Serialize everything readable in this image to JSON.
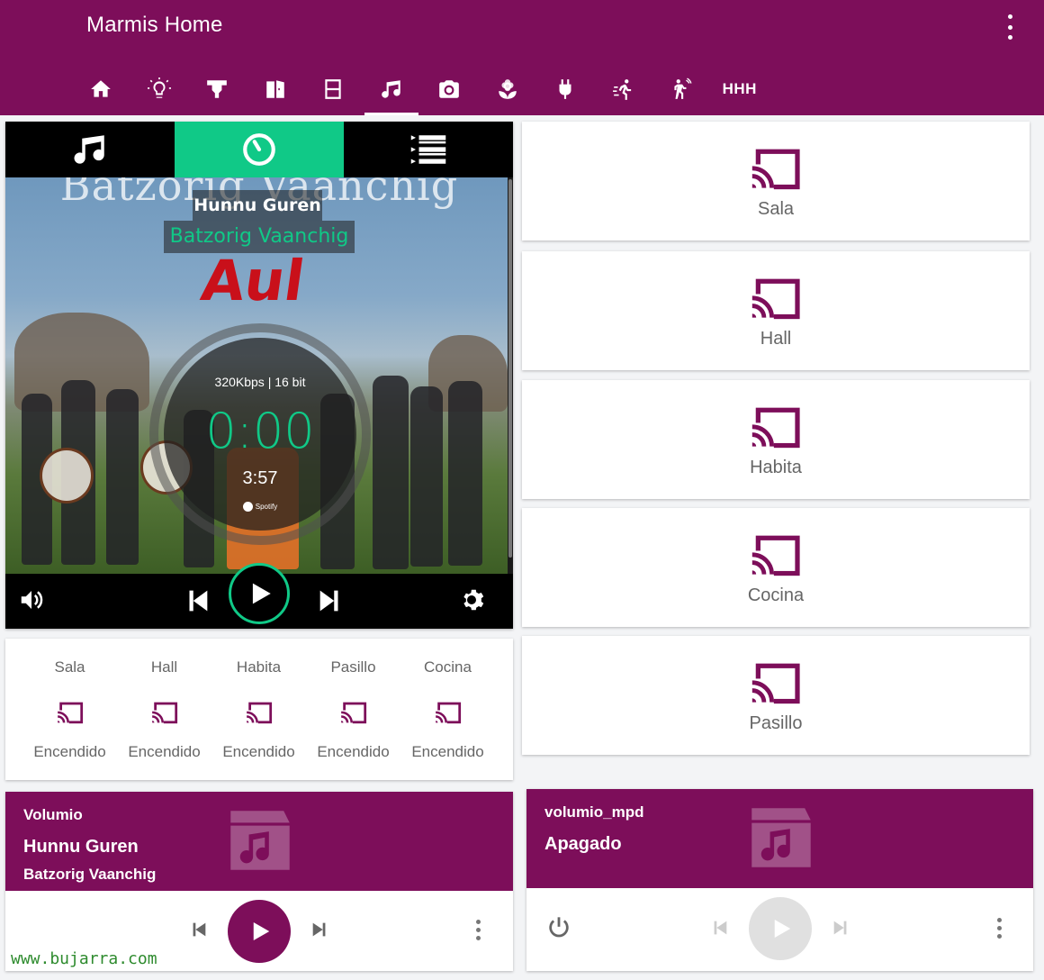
{
  "app": {
    "title": "Marmis Home",
    "accent": "#7d0e5a",
    "volumio_green": "#10c987"
  },
  "tabs": [
    {
      "icon": "home-icon"
    },
    {
      "icon": "lightbulb-icon"
    },
    {
      "icon": "projector-icon"
    },
    {
      "icon": "door-icon"
    },
    {
      "icon": "window-icon"
    },
    {
      "icon": "music-note-icon",
      "active": true
    },
    {
      "icon": "camera-icon"
    },
    {
      "icon": "flower-icon"
    },
    {
      "icon": "plug-icon"
    },
    {
      "icon": "run-icon"
    },
    {
      "icon": "walk-motion-icon"
    },
    {
      "label": "HHH"
    }
  ],
  "player": {
    "band_text": "Batzorig Vaanchig",
    "album_text": "Aul",
    "track": "Hunnu Guren",
    "artist": "Batzorig Vaanchig",
    "bitrate": "320Kbps | 16 bit",
    "elapsed": "0:00",
    "duration": "3:57",
    "service": "Spotify"
  },
  "speakers": [
    {
      "name": "Sala",
      "status": "Encendido"
    },
    {
      "name": "Hall",
      "status": "Encendido"
    },
    {
      "name": "Habita",
      "status": "Encendido"
    },
    {
      "name": "Pasillo",
      "status": "Encendido"
    },
    {
      "name": "Cocina",
      "status": "Encendido"
    }
  ],
  "cast_devices": [
    "Sala",
    "Hall",
    "Habita",
    "Cocina",
    "Pasillo"
  ],
  "media_players": [
    {
      "source": "Volumio",
      "title": "Hunnu Guren",
      "subtitle": "Batzorig Vaanchig"
    },
    {
      "source": "volumio_mpd",
      "title": "Apagado"
    }
  ],
  "watermark": "www.bujarra.com"
}
